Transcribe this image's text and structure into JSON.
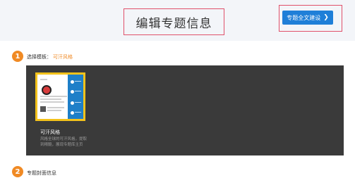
{
  "header": {
    "title": "编辑专题信息",
    "action_button": {
      "label": "专题全文建设",
      "icon": "chevron-right-icon"
    }
  },
  "steps": [
    {
      "number": "1",
      "label": "选择模板：",
      "value": "可汗风格"
    },
    {
      "number": "2",
      "label": "专题封面信息"
    }
  ],
  "template": {
    "name": "可汗风格",
    "description": "风格全球的可汗风格，提取到精髓，展现专题库主页"
  },
  "colors": {
    "accent": "#f08a24",
    "primary": "#1f7fd8",
    "highlight_border": "#f3c21b",
    "annotation_border": "#e0506a"
  }
}
